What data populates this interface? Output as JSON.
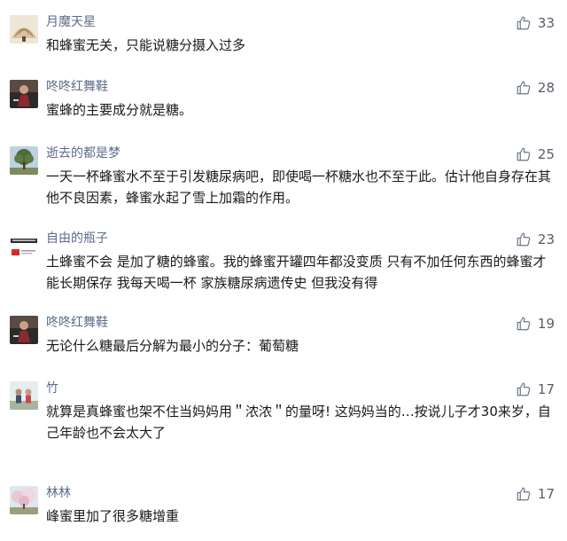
{
  "comments": [
    {
      "name": "月魔天星",
      "likes": "33",
      "text": "和蜂蜜无关，只能说糖分摄入过多",
      "avatar": "fan-painting"
    },
    {
      "name": "咚咚红舞鞋",
      "likes": "28",
      "text": "蜜蜂的主要成分就是糖。",
      "avatar": "dancer-photo"
    },
    {
      "name": "逝去的都是梦",
      "likes": "25",
      "text": "一天一杯蜂蜜水不至于引发糖尿病吧，即使喝一杯糖水也不至于此。估计他自身存在其他不良因素，蜂蜜水起了雪上加霜的作用。",
      "avatar": "tree-photo"
    },
    {
      "name": "自由的瓶子",
      "likes": "23",
      "text": "土蜂蜜不会 是加了糖的蜂蜜。我的蜂蜜开罐四年都没变质 只有不加任何东西的蜂蜜才能长期保存 我每天喝一杯 家族糖尿病遗传史 但我没有得",
      "avatar": "logo-badge"
    },
    {
      "name": "咚咚红舞鞋",
      "likes": "19",
      "text": "无论什么糖最后分解为最小的分子：葡萄糖",
      "avatar": "dancer-photo"
    },
    {
      "name": "竹",
      "likes": "17",
      "text": "就算是真蜂蜜也架不住当妈妈用＂浓浓＂的量呀! 这妈妈当的…按说儿子才30来岁，自己年龄也不会太大了",
      "avatar": "people-photo"
    },
    {
      "name": "林林",
      "likes": "17",
      "text": "峰蜜里加了很多糖增重",
      "avatar": "blossom-photo"
    }
  ],
  "like_icon": "thumbs-up-icon",
  "colors": {
    "name": "#5c6b8a",
    "text": "#1a1a1a",
    "like_icon": "#6b7687",
    "like_count": "#555d6b",
    "background": "#ffffff"
  }
}
